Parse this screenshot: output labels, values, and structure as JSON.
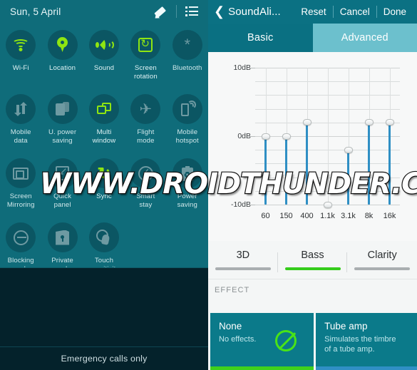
{
  "quick_settings": {
    "date": "Sun, 5 April",
    "edit_icon": "pencil-icon",
    "list_icon": "list-menu-icon",
    "toggles": [
      {
        "label": "Wi-Fi",
        "icon": "wifi-icon",
        "state": "on"
      },
      {
        "label": "Location",
        "icon": "location-pin-icon",
        "state": "on"
      },
      {
        "label": "Sound",
        "icon": "speaker-icon",
        "state": "on"
      },
      {
        "label": "Screen\nrotation",
        "icon": "screen-rotation-icon",
        "state": "on"
      },
      {
        "label": "Bluetooth",
        "icon": "bluetooth-icon",
        "state": "off"
      },
      {
        "label": "Mobile\ndata",
        "icon": "mobile-data-icon",
        "state": "off"
      },
      {
        "label": "U. power\nsaving",
        "icon": "ultra-power-saving-icon",
        "state": "off"
      },
      {
        "label": "Multi\nwindow",
        "icon": "multi-window-icon",
        "state": "on"
      },
      {
        "label": "Flight\nmode",
        "icon": "airplane-icon",
        "state": "off"
      },
      {
        "label": "Mobile\nhotspot",
        "icon": "mobile-hotspot-icon",
        "state": "off"
      },
      {
        "label": "Screen\nMirroring",
        "icon": "screen-mirroring-icon",
        "state": "off"
      },
      {
        "label": "Quick\npanel",
        "icon": "quick-panel-icon",
        "state": "off"
      },
      {
        "label": "Sync",
        "icon": "sync-icon",
        "state": "on"
      },
      {
        "label": "Smart\nstay",
        "icon": "smart-stay-icon",
        "state": "off"
      },
      {
        "label": "Power\nsaving",
        "icon": "power-saving-icon",
        "state": "off"
      },
      {
        "label": "Blocking\nmode",
        "icon": "blocking-mode-icon",
        "state": "off"
      },
      {
        "label": "Private\nmode",
        "icon": "private-mode-icon",
        "state": "off"
      },
      {
        "label": "Touch\nsensitivity",
        "icon": "touch-sensitivity-icon",
        "state": "off"
      }
    ],
    "status_text": "Emergency calls only"
  },
  "soundalive": {
    "back_icon": "back-chevron-icon",
    "title": "SoundAli...",
    "actions": [
      "Reset",
      "Cancel",
      "Done"
    ],
    "tabs": [
      {
        "label": "Basic",
        "selected": false
      },
      {
        "label": "Advanced",
        "selected": true
      }
    ],
    "chart_data": {
      "type": "bar",
      "title": "",
      "xlabel": "",
      "ylabel": "dB",
      "categories": [
        "60",
        "150",
        "400",
        "1.1k",
        "3.1k",
        "8k",
        "16k"
      ],
      "values": [
        0,
        0,
        2,
        -10,
        -2,
        2,
        2
      ],
      "ylim": [
        -10,
        10
      ],
      "ytick_labels": [
        "10dB",
        "0dB",
        "-10dB"
      ],
      "ytick_values": [
        10,
        0,
        -10
      ],
      "grid": true,
      "gridline_step_db": 2,
      "legend": "none",
      "series_color": "#2f8fc4"
    },
    "sliders": [
      {
        "label": "3D",
        "value": 0,
        "filled": false
      },
      {
        "label": "Bass",
        "value": 100,
        "filled": true
      },
      {
        "label": "Clarity",
        "value": 0,
        "filled": false
      }
    ],
    "effect_section_label": "EFFECT",
    "effects": [
      {
        "title": "None",
        "desc": "No effects.",
        "icon": "ban-icon",
        "selected": true,
        "bar_color": "#3fd11c"
      },
      {
        "title": "Tube amp",
        "desc": "Simulates the timbre\nof a tube amp.",
        "icon": "",
        "selected": false,
        "bar_color": "#2f8fc4"
      }
    ]
  },
  "watermark": {
    "text": "WWW.DROIDTHUNDER.COM"
  },
  "colors": {
    "panel_teal": "#0f6c7a",
    "header_teal": "#0b7183",
    "tab_active": "#6cc0cd",
    "accent_green": "#8fe511",
    "slider_blue": "#2f8fc4",
    "dark_navy": "#04222b"
  }
}
